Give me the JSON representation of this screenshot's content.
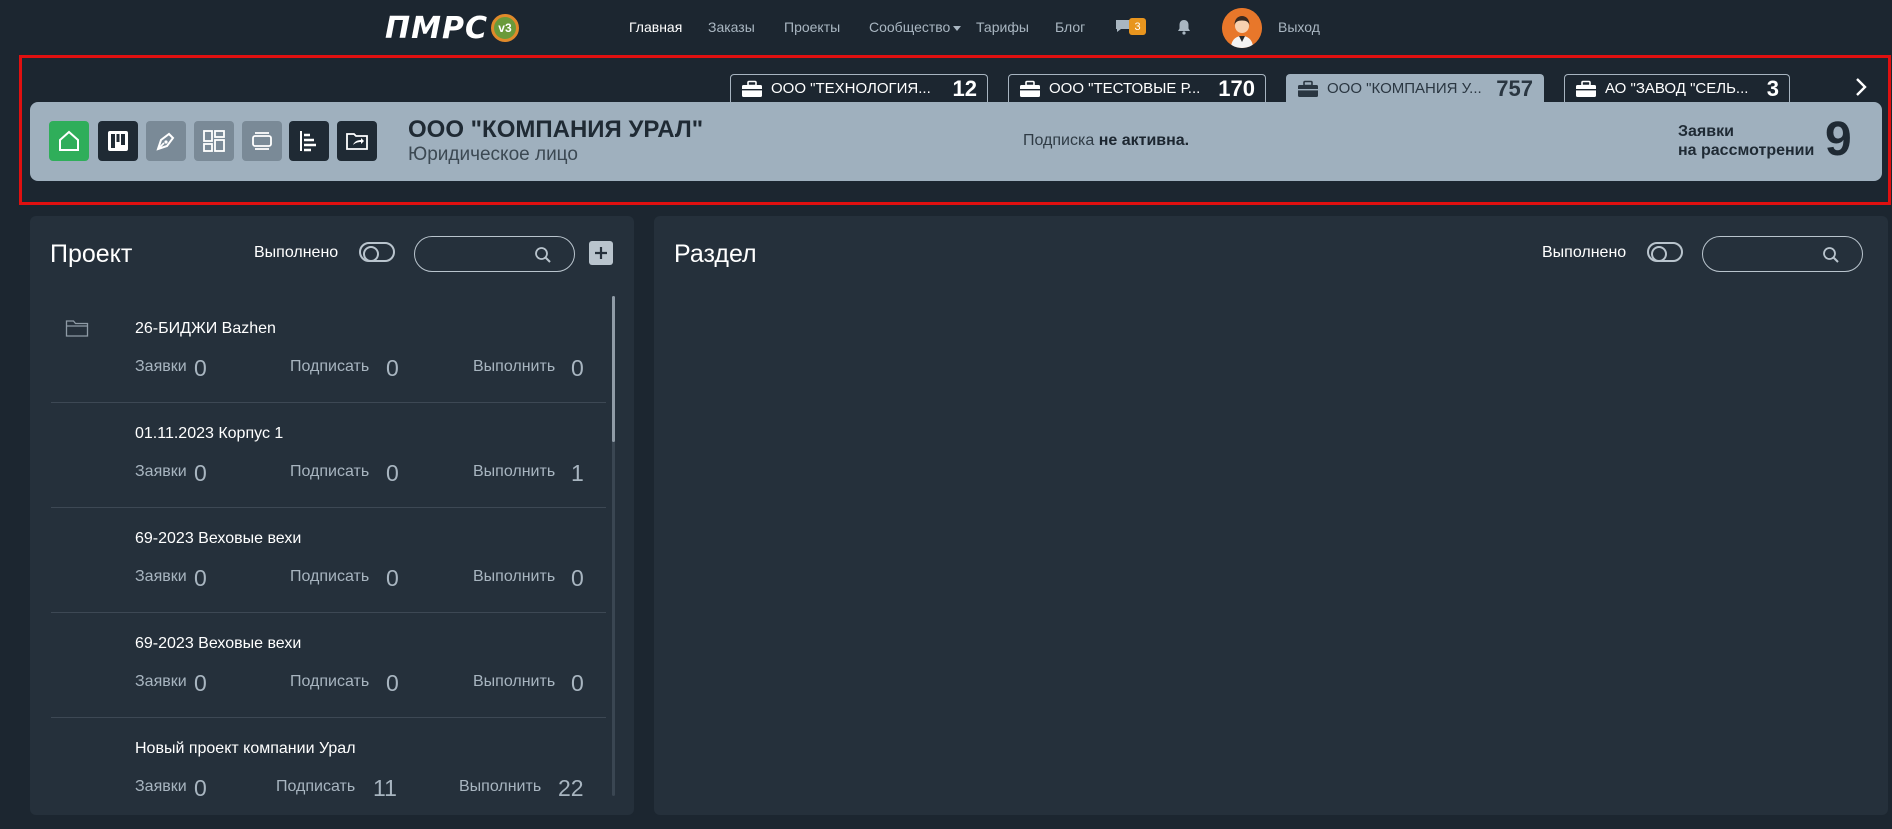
{
  "nav": {
    "logo": "ПМРС",
    "logo_version": "v3",
    "links": [
      "Главная",
      "Заказы",
      "Проекты",
      "Сообщество",
      "Тарифы",
      "Блог"
    ],
    "chat_badge": "3",
    "exit_label": "Выход",
    "icons": [
      "chat-icon",
      "bell-icon",
      "avatar"
    ]
  },
  "tabs": [
    {
      "name": "ООО \"ТЕХНОЛОГИЯ...",
      "count": "12"
    },
    {
      "name": "ООО \"ТЕСТОВЫЕ Р...",
      "count": "170"
    },
    {
      "name": "ООО \"КОМПАНИЯ У...",
      "count": "757"
    },
    {
      "name": "АО \"ЗАВОД \"СЕЛЬ...",
      "count": "3"
    }
  ],
  "company": {
    "name": "ООО \"КОМПАНИЯ УРАЛ\"",
    "type": "Юридическое лицо",
    "subscription_prefix": "Подписка ",
    "subscription_status": "не активна.",
    "requests_label_1": "Заявки",
    "requests_label_2": "на рассмотрении",
    "requests_count": "9",
    "toolbar_icons": [
      "home-icon",
      "kanban-icon",
      "pen-icon",
      "grid-icon",
      "layers-icon",
      "hierarchy-icon",
      "folder-share-icon"
    ],
    "colors": {
      "home": "#2fae5a",
      "dark": "#1f2a34",
      "gray": "#7a8a97"
    }
  },
  "project_panel": {
    "title": "Проект",
    "done_label": "Выполнено",
    "search_placeholder": "",
    "projects": [
      {
        "title": "26-БИДЖИ Bazhen",
        "requests_label": "Заявки",
        "requests": "0",
        "sign_label": "Подписать",
        "sign": "0",
        "exec_label": "Выполнить",
        "exec": "0"
      },
      {
        "title": "01.11.2023 Корпус 1",
        "requests_label": "Заявки",
        "requests": "0",
        "sign_label": "Подписать",
        "sign": "0",
        "exec_label": "Выполнить",
        "exec": "1"
      },
      {
        "title": "69-2023 Веховые вехи",
        "requests_label": "Заявки",
        "requests": "0",
        "sign_label": "Подписать",
        "sign": "0",
        "exec_label": "Выполнить",
        "exec": "0"
      },
      {
        "title": "69-2023 Веховые вехи",
        "requests_label": "Заявки",
        "requests": "0",
        "sign_label": "Подписать",
        "sign": "0",
        "exec_label": "Выполнить",
        "exec": "0"
      },
      {
        "title": "Новый проект компании Урал",
        "requests_label": "Заявки",
        "requests": "0",
        "sign_label": "Подписать",
        "sign": "11",
        "exec_label": "Выполнить",
        "exec": "22"
      }
    ]
  },
  "section_panel": {
    "title": "Раздел",
    "done_label": "Выполнено",
    "search_placeholder": ""
  }
}
